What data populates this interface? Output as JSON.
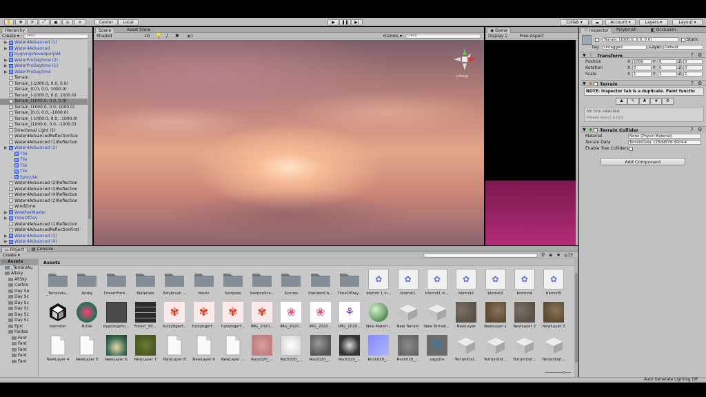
{
  "toolbar": {
    "center_label": "Center",
    "local_label": "Local",
    "collab_label": "Collab ▾",
    "account_label": "Account ▾",
    "layers_label": "Layers ▾",
    "layout_label": "Layout ▾"
  },
  "hierarchy": {
    "tab": "Hierarchy",
    "create_label": "Create ▾",
    "search_placeholder": "Q▾All",
    "items": [
      {
        "label": "Water4Advanced (1)",
        "indent": 1,
        "blue": true,
        "arrow": true
      },
      {
        "label": "Water4Advanced",
        "indent": 1,
        "blue": true,
        "arrow": true
      },
      {
        "label": "bygningshovedporjakt",
        "indent": 1,
        "blue": true,
        "arrow": false
      },
      {
        "label": "WaterProDaytime (2)",
        "indent": 1,
        "blue": true,
        "arrow": true
      },
      {
        "label": "WaterProDaytime (1)",
        "indent": 1,
        "blue": true,
        "arrow": true
      },
      {
        "label": "WaterProDaytime",
        "indent": 1,
        "blue": true,
        "arrow": true
      },
      {
        "label": "Terrain",
        "indent": 1,
        "blue": false,
        "arrow": false
      },
      {
        "label": "Terrain_(-1000.0, 0.0, 0.0)",
        "indent": 1,
        "blue": false,
        "arrow": false
      },
      {
        "label": "Terrain_(0.0, 0.0, 1000.0)",
        "indent": 1,
        "blue": false,
        "arrow": false
      },
      {
        "label": "Terrain_(-1000.0, 0.0, 1000.0)",
        "indent": 1,
        "blue": false,
        "arrow": false
      },
      {
        "label": "Terrain_(1000.0, 0.0, 0.0)",
        "indent": 1,
        "blue": false,
        "arrow": false,
        "selected": true
      },
      {
        "label": "Terrain_(1000.0, 0.0, 1000.0)",
        "indent": 1,
        "blue": false,
        "arrow": false
      },
      {
        "label": "Terrain_(0.0, 0.0, -1000.0)",
        "indent": 1,
        "blue": false,
        "arrow": false
      },
      {
        "label": "Terrain_(-1000.0, 0.0, -1000.0)",
        "indent": 1,
        "blue": false,
        "arrow": false
      },
      {
        "label": "Terrain_(1000.0, 0.0, -1000.0)",
        "indent": 1,
        "blue": false,
        "arrow": false
      },
      {
        "label": "Directional Light (1)",
        "indent": 1,
        "blue": false,
        "arrow": false
      },
      {
        "label": "Water4AdvancedReflectionSce",
        "indent": 1,
        "blue": false,
        "arrow": false
      },
      {
        "label": "Water4Advanced (1)Reflection",
        "indent": 1,
        "blue": false,
        "arrow": false
      },
      {
        "label": "Water4Advanced (2)",
        "indent": 1,
        "blue": true,
        "arrow": true
      },
      {
        "label": "Tile",
        "indent": 2,
        "blue": true,
        "arrow": false
      },
      {
        "label": "Tile",
        "indent": 2,
        "blue": true,
        "arrow": false
      },
      {
        "label": "Tile",
        "indent": 2,
        "blue": true,
        "arrow": false
      },
      {
        "label": "Tile",
        "indent": 2,
        "blue": true,
        "arrow": false
      },
      {
        "label": "Specular",
        "indent": 2,
        "blue": true,
        "arrow": false
      },
      {
        "label": "Water4Advanced (2)Reflection",
        "indent": 1,
        "blue": false,
        "arrow": false
      },
      {
        "label": "Water4Advanced (3)Reflection",
        "indent": 1,
        "blue": false,
        "arrow": false
      },
      {
        "label": "Water4Advanced (4)Reflection",
        "indent": 1,
        "blue": false,
        "arrow": false
      },
      {
        "label": "Water4Advanced (2)Reflection",
        "indent": 1,
        "blue": false,
        "arrow": false
      },
      {
        "label": "WindZone",
        "indent": 1,
        "blue": false,
        "arrow": false
      },
      {
        "label": "WeatherMaster",
        "indent": 1,
        "blue": true,
        "arrow": true
      },
      {
        "label": "TimeOfDay",
        "indent": 1,
        "blue": true,
        "arrow": true
      },
      {
        "label": "Water4Advanced (1)Reflection",
        "indent": 1,
        "blue": false,
        "arrow": false
      },
      {
        "label": "Water4AdvancedReflectionFirst",
        "indent": 1,
        "blue": false,
        "arrow": false
      },
      {
        "label": "Water4Advanced (3)",
        "indent": 1,
        "blue": true,
        "arrow": true
      },
      {
        "label": "Water4Advanced (4)",
        "indent": 1,
        "blue": true,
        "arrow": true
      }
    ]
  },
  "scene": {
    "tab_scene": "Scene",
    "tab_store": "Asset Store",
    "shaded_label": "Shaded",
    "mode_2d": "2D",
    "gizmos_label": "Gizmos ▾",
    "search_placeholder": "Q▾All",
    "persp_label": "◁ Persp"
  },
  "game": {
    "tab": "Game",
    "display_label": "Display 1",
    "aspect_label": "Free Aspect"
  },
  "inspector": {
    "tab_inspector": "Inspector",
    "tab_polybrush": "Polybrush",
    "tab_occlusion": "Occlusion",
    "object_name": "Terrain_(1000.0, 0.0, 0.0)",
    "static_label": "Static",
    "tag_label": "Tag",
    "tag_value": "Untagged",
    "layer_label": "Layer",
    "layer_value": "Default",
    "transform": {
      "title": "Transform",
      "position_label": "Position",
      "rotation_label": "Rotation",
      "scale_label": "Scale",
      "position": [
        "1000",
        "0",
        "0"
      ],
      "rotation": [
        "0",
        "0",
        "0"
      ],
      "scale": [
        "1",
        "1",
        "1"
      ]
    },
    "terrain": {
      "title": "Terrain",
      "note": "NOTE: Inspector tab is a duplicate.  Paint functio",
      "no_tool": "No tool selected",
      "select_tool": "Please select a tool"
    },
    "collider": {
      "title": "Terrain Collider",
      "material_label": "Material",
      "material_value": "None (Physic Material)",
      "data_label": "Terrain Data",
      "data_value": "TerrainData_c25dd97d-30c4-4",
      "tree_label": "Enable Tree Colliders"
    },
    "add_component": "Add Component"
  },
  "project": {
    "tab_project": "Project",
    "tab_console": "Console",
    "create_label": "Create ▾",
    "breadcrumb": "Assets",
    "count": "13",
    "folders": [
      {
        "label": "Assets",
        "indent": 0
      },
      {
        "label": "_TerrainAu",
        "indent": 1
      },
      {
        "label": "Allsky",
        "indent": 1
      },
      {
        "label": "AllSky",
        "indent": 2
      },
      {
        "label": "Cartoo",
        "indent": 2
      },
      {
        "label": "Day So",
        "indent": 2
      },
      {
        "label": "Day Sc",
        "indent": 2
      },
      {
        "label": "Day Sc",
        "indent": 2
      },
      {
        "label": "Day Sc",
        "indent": 2
      },
      {
        "label": "Day Sc",
        "indent": 2
      },
      {
        "label": "Day Sc",
        "indent": 2
      },
      {
        "label": "Epic",
        "indent": 2
      },
      {
        "label": "Fantas",
        "indent": 2
      },
      {
        "label": "Fant",
        "indent": 3
      },
      {
        "label": "Fant",
        "indent": 3
      },
      {
        "label": "Fant",
        "indent": 3
      },
      {
        "label": "Fant",
        "indent": 3
      },
      {
        "label": "Fant",
        "indent": 3
      }
    ],
    "assets": [
      {
        "label": "_TerrainAu...",
        "kind": "folder"
      },
      {
        "label": "Allsky",
        "kind": "folder"
      },
      {
        "label": "DreamFore...",
        "kind": "folder"
      },
      {
        "label": "Materials",
        "kind": "folder"
      },
      {
        "label": "Polybrush ...",
        "kind": "folder"
      },
      {
        "label": "Rocks",
        "kind": "folder"
      },
      {
        "label": "Samples",
        "kind": "folder"
      },
      {
        "label": "SampleSce...",
        "kind": "folder"
      },
      {
        "label": "Scenes",
        "kind": "folder"
      },
      {
        "label": "Standard A...",
        "kind": "folder"
      },
      {
        "label": "TimeOfDay...",
        "kind": "folder"
      },
      {
        "label": "blomst 1 vi...",
        "kind": "sketch"
      },
      {
        "label": "blomst1",
        "kind": "sketch"
      },
      {
        "label": "blomst1 vi...",
        "kind": "sketch"
      },
      {
        "label": "blomst2",
        "kind": "sketch"
      },
      {
        "label": "blomst3",
        "kind": "sketch"
      },
      {
        "label": "blomst4",
        "kind": "sketch"
      },
      {
        "label": "blomst5",
        "kind": "sketch"
      },
      {
        "label": "blomster",
        "kind": "unity"
      },
      {
        "label": "BUSK",
        "kind": "bush"
      },
      {
        "label": "bygningsho...",
        "kind": "dark"
      },
      {
        "label": "Forest_S0...",
        "kind": "stripe"
      },
      {
        "label": "fuzzytigerf...",
        "kind": "red"
      },
      {
        "label": "fuzzytigerf...",
        "kind": "red"
      },
      {
        "label": "fuzzytigerf...",
        "kind": "red"
      },
      {
        "label": "IMG_2020...",
        "kind": "red"
      },
      {
        "label": "IMG_2020...",
        "kind": "pink"
      },
      {
        "label": "IMG_2020...",
        "kind": "pink"
      },
      {
        "label": "IMG_2020...",
        "kind": "purple"
      },
      {
        "label": "New Materi...",
        "kind": "sphere"
      },
      {
        "label": "New Terrain",
        "kind": "cube"
      },
      {
        "label": "New Terrain...",
        "kind": "cube"
      },
      {
        "label": "NewLayer",
        "kind": "dirt"
      },
      {
        "label": "NewLayer 1",
        "kind": "brown"
      },
      {
        "label": "NewLayer 2",
        "kind": "dirt"
      },
      {
        "label": "NewLayer 3",
        "kind": "brown"
      },
      {
        "label": "NewLayer 4",
        "kind": "doc"
      },
      {
        "label": "NewLayer 5",
        "kind": "doc"
      },
      {
        "label": "NewLayer 6",
        "kind": "gradient"
      },
      {
        "label": "NewLayer 7",
        "kind": "moss"
      },
      {
        "label": "NewLayer 8",
        "kind": "doc"
      },
      {
        "label": "NewLayer 9",
        "kind": "doc"
      },
      {
        "label": "NewLayer ...",
        "kind": "doc"
      },
      {
        "label": "Rock020_...",
        "kind": "rosy"
      },
      {
        "label": "Rock020_...",
        "kind": "white"
      },
      {
        "label": "Rock020_...",
        "kind": "rock"
      },
      {
        "label": "Rock020_...",
        "kind": "rockdark"
      },
      {
        "label": "Rock020_...",
        "kind": "normal"
      },
      {
        "label": "Rock020_...",
        "kind": "grayrock"
      },
      {
        "label": "sapptre",
        "kind": "tree"
      },
      {
        "label": "TerrainDat...",
        "kind": "cube"
      },
      {
        "label": "TerrainDat...",
        "kind": "cube"
      },
      {
        "label": "TerrainDat...",
        "kind": "cube"
      },
      {
        "label": "TerrainDat...",
        "kind": "cube"
      }
    ]
  },
  "status": {
    "text": "Auto Generate Lighting Off"
  },
  "colors": {
    "panel": "#c8c8c8",
    "hierarchy_blue": "#1d3fd0",
    "selection": "#8e8e8e",
    "game_magenta": "#7a1850"
  }
}
